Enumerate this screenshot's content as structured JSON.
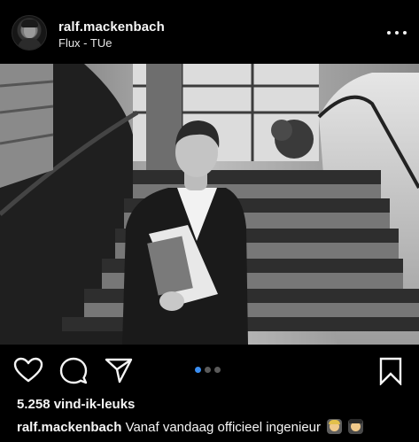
{
  "post": {
    "username": "ralf.mackenbach",
    "location": "Flux - TUe"
  },
  "photo": {
    "description_icon": "photo-image"
  },
  "actions": {
    "icons": [
      "heart-icon",
      "comment-icon",
      "share-icon",
      "bookmark-icon"
    ],
    "carousel_total": 3,
    "carousel_active": 1,
    "accent_color": "#3a8ef2"
  },
  "likes": {
    "text": "5.258 vind-ik-leuks"
  },
  "caption": {
    "username": "ralf.mackenbach",
    "text": "Vanaf vandaag officieel ingenieur",
    "emojis": [
      "woman-graduate-emoji",
      "man-graduate-emoji"
    ]
  }
}
